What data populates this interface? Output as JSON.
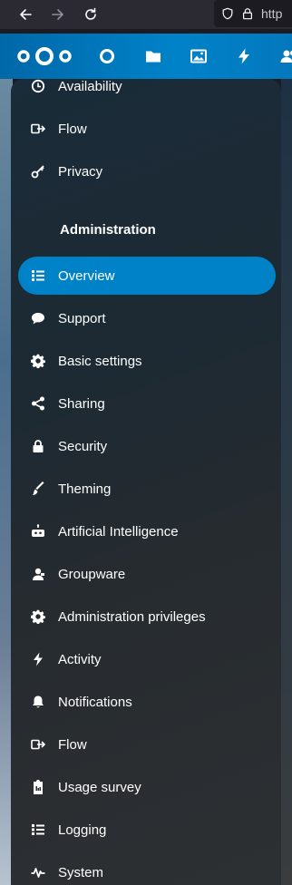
{
  "browser": {
    "url_partial": "http"
  },
  "sidebar": {
    "top_items": [
      {
        "label": "Availability",
        "icon": "clock-icon"
      },
      {
        "label": "Flow",
        "icon": "flow-icon"
      },
      {
        "label": "Privacy",
        "icon": "key-icon"
      }
    ],
    "section_heading": "Administration",
    "admin_items": [
      {
        "label": "Overview",
        "icon": "list-icon",
        "active": true
      },
      {
        "label": "Support",
        "icon": "speech-bubble-icon"
      },
      {
        "label": "Basic settings",
        "icon": "gear-icon"
      },
      {
        "label": "Sharing",
        "icon": "share-icon"
      },
      {
        "label": "Security",
        "icon": "lock-icon"
      },
      {
        "label": "Theming",
        "icon": "brush-icon"
      },
      {
        "label": "Artificial Intelligence",
        "icon": "robot-icon"
      },
      {
        "label": "Groupware",
        "icon": "groupware-icon"
      },
      {
        "label": "Administration privileges",
        "icon": "gear-icon"
      },
      {
        "label": "Activity",
        "icon": "lightning-icon"
      },
      {
        "label": "Notifications",
        "icon": "bell-icon"
      },
      {
        "label": "Flow",
        "icon": "flow-icon"
      },
      {
        "label": "Usage survey",
        "icon": "clipboard-icon"
      },
      {
        "label": "Logging",
        "icon": "list-icon"
      },
      {
        "label": "System",
        "icon": "pulse-icon"
      }
    ]
  },
  "colors": {
    "header_blue": "#0082c9",
    "active_item": "#0082c9",
    "text": "#ffffff"
  }
}
